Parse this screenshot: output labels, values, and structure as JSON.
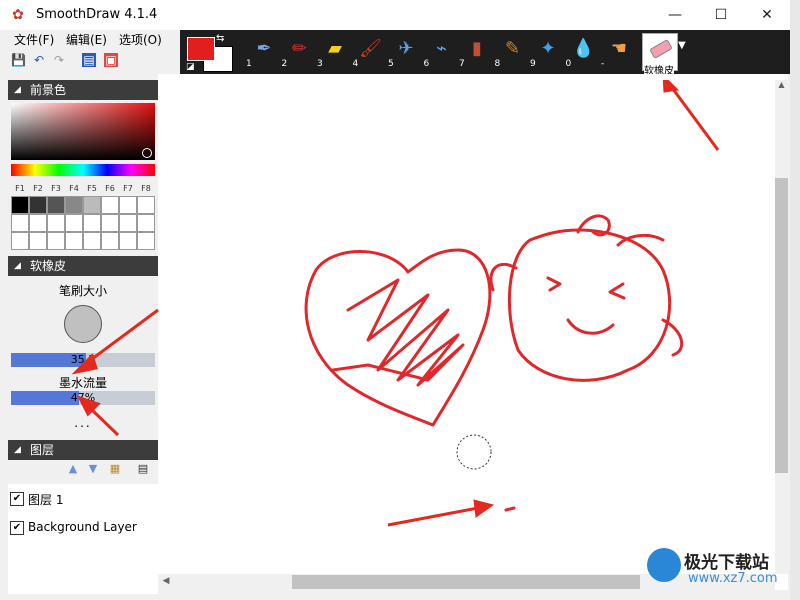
{
  "window": {
    "title": "SmoothDraw 4.1.4",
    "app_icon": "flower-icon",
    "controls": {
      "minimize": "—",
      "maximize": "☐",
      "close": "✕"
    }
  },
  "menu": {
    "file": "文件(F)",
    "edit": "编辑(E)",
    "options": "选项(O)"
  },
  "toolbar": {
    "foreground_color": "#e21e1e",
    "background_color": "#ffffff",
    "tools": [
      {
        "num": "1",
        "icon": "pen-icon"
      },
      {
        "num": "2",
        "icon": "pencil-icon"
      },
      {
        "num": "3",
        "icon": "highlighter-icon"
      },
      {
        "num": "4",
        "icon": "brush-icon"
      },
      {
        "num": "5",
        "icon": "airbrush-icon"
      },
      {
        "num": "6",
        "icon": "spray-icon"
      },
      {
        "num": "7",
        "icon": "flat-brush-icon"
      },
      {
        "num": "8",
        "icon": "ink-brush-icon"
      },
      {
        "num": "9",
        "icon": "sparkle-icon"
      },
      {
        "num": "0",
        "icon": "water-drop-icon"
      },
      {
        "num": "-",
        "icon": "smudge-hand-icon"
      }
    ],
    "selected_tool": "软橡皮"
  },
  "panels": {
    "foreground": {
      "title": "前景色",
      "fkeys": [
        "F1",
        "F2",
        "F3",
        "F4",
        "F5",
        "F6",
        "F7",
        "F8"
      ],
      "swatches_row1": [
        "#000000",
        "#333333",
        "#555555",
        "#888888",
        "#bbbbbb",
        "#ffffff",
        "#ffffff",
        "#ffffff"
      ]
    },
    "eraser": {
      "title": "软橡皮",
      "brush_size_label": "笔刷大小",
      "brush_size": 35.5,
      "brush_size_text": "35.5",
      "brush_size_fraction": 0.52,
      "ink_flow_label": "墨水流量",
      "ink_flow_text": "47%",
      "ink_flow_fraction": 0.47,
      "more": "..."
    },
    "layers": {
      "title": "图层",
      "items": [
        {
          "name": "图层 1",
          "visible": true
        },
        {
          "name": "Background Layer",
          "visible": true
        }
      ]
    }
  },
  "watermark": {
    "text": "极光下载站",
    "url": "www.xz7.com"
  },
  "colors": {
    "stroke": "#e0282c",
    "annotation_arrow": "#e5281e",
    "accent_slider": "#5577d8"
  }
}
